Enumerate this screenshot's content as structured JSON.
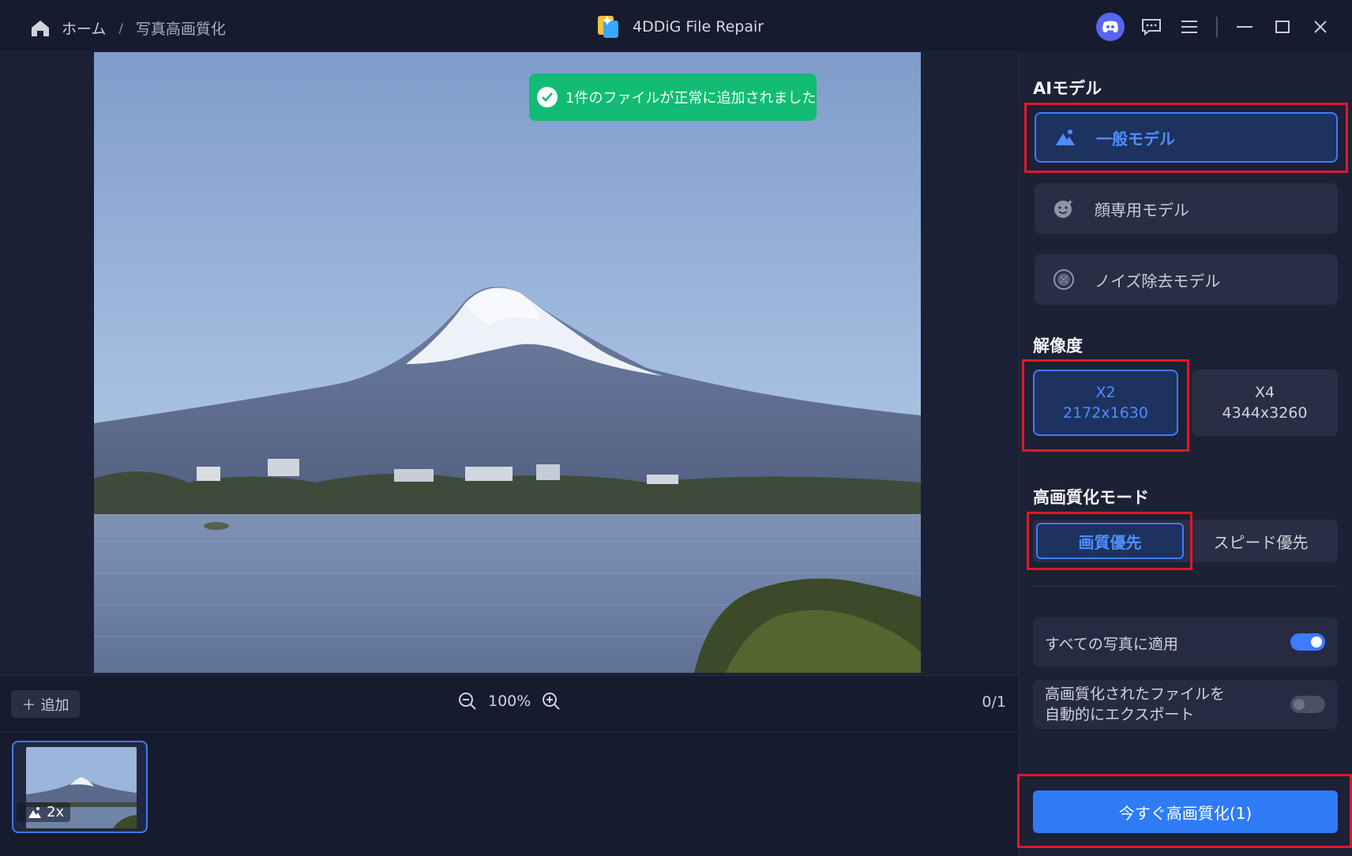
{
  "breadcrumb": {
    "home": "ホーム",
    "separator": "/",
    "current": "写真高画質化"
  },
  "app": {
    "title": "4DDiG File Repair"
  },
  "toast": {
    "message": "1件のファイルが正常に追加されました"
  },
  "toolbar": {
    "add_label": "追加",
    "zoom": "100%",
    "page_count": "0/1"
  },
  "thumbnail": {
    "badge": "2x"
  },
  "ai_model": {
    "title": "AIモデル",
    "options": [
      {
        "label": "一般モデル",
        "icon": "mountain-icon",
        "selected": true
      },
      {
        "label": "顔専用モデル",
        "icon": "face-icon",
        "selected": false
      },
      {
        "label": "ノイズ除去モデル",
        "icon": "noise-icon",
        "selected": false
      }
    ]
  },
  "resolution": {
    "title": "解像度",
    "options": [
      {
        "label": "X2",
        "size": "2172x1630",
        "selected": true
      },
      {
        "label": "X4",
        "size": "4344x3260",
        "selected": false
      }
    ]
  },
  "enhance_mode": {
    "title": "高画質化モード",
    "options": [
      {
        "label": "画質優先",
        "selected": true
      },
      {
        "label": "スピード優先",
        "selected": false
      }
    ]
  },
  "settings": {
    "apply_all": {
      "label": "すべての写真に適用",
      "enabled": true
    },
    "auto_export": {
      "line1": "高画質化されたファイルを",
      "line2": "自動的にエクスポート",
      "enabled": false
    }
  },
  "cta": {
    "label": "今すぐ高画質化(1)"
  },
  "colors": {
    "accent": "#3d7bff",
    "highlight_box": "#e0172a",
    "toast": "#12bc74",
    "cta": "#2f7bf6"
  }
}
